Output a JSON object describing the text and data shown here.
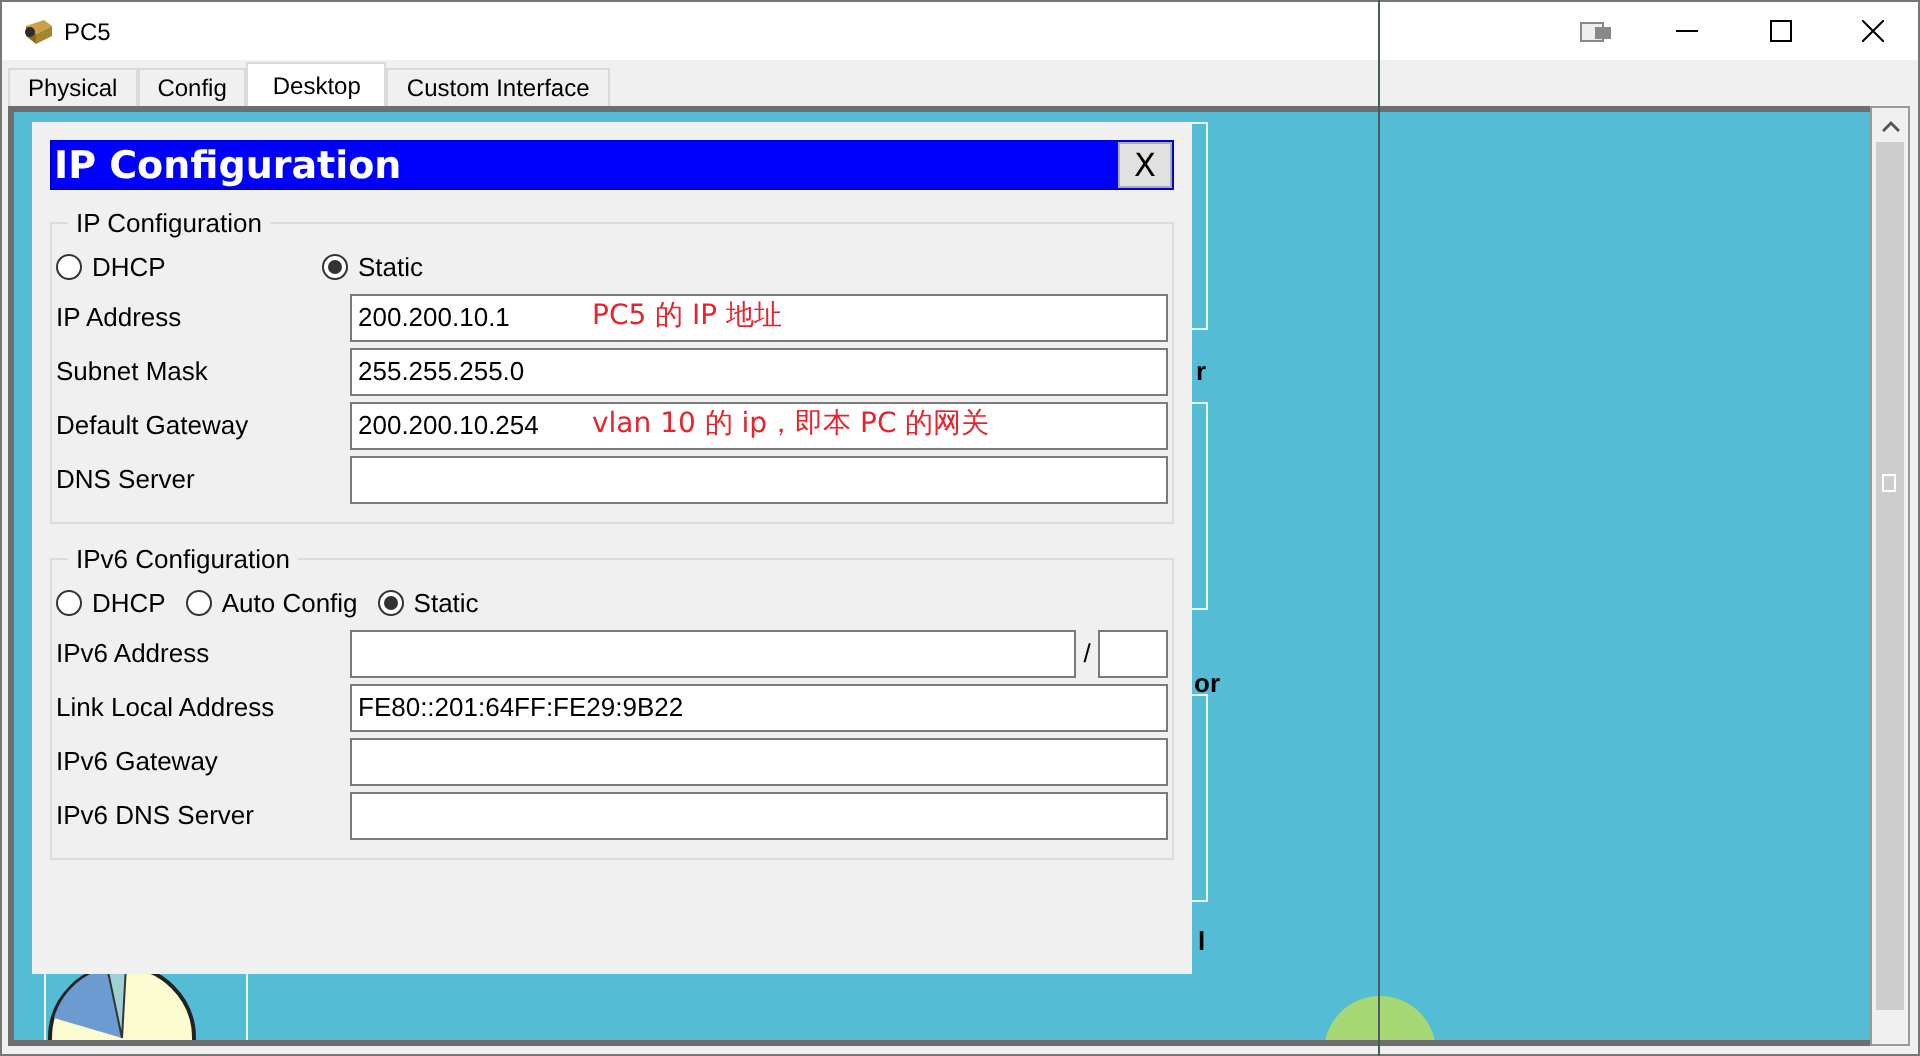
{
  "window": {
    "title": "PC5"
  },
  "tabs": [
    {
      "label": "Physical",
      "selected": false
    },
    {
      "label": "Config",
      "selected": false
    },
    {
      "label": "Desktop",
      "selected": true
    },
    {
      "label": "Custom Interface",
      "selected": false
    }
  ],
  "desktop": {
    "fragments": [
      "r",
      "or",
      "l"
    ]
  },
  "dialog": {
    "title": "IP Configuration",
    "close": "X",
    "ipv4": {
      "legend": "IP Configuration",
      "modes": [
        {
          "label": "DHCP",
          "selected": false
        },
        {
          "label": "Static",
          "selected": true
        }
      ],
      "fields": [
        {
          "label": "IP Address",
          "value": "200.200.10.1",
          "note": "PC5 的 IP 地址"
        },
        {
          "label": "Subnet Mask",
          "value": "255.255.255.0"
        },
        {
          "label": "Default Gateway",
          "value": "200.200.10.254",
          "note": "vlan 10 的 ip，即本 PC 的网关"
        },
        {
          "label": "DNS Server"
        }
      ]
    },
    "ipv6": {
      "legend": "IPv6 Configuration",
      "modes": [
        {
          "label": "DHCP",
          "selected": false
        },
        {
          "label": "Auto Config",
          "selected": false
        },
        {
          "label": "Static",
          "selected": true
        }
      ],
      "fields": [
        {
          "label": "IPv6 Address",
          "kind": "prefix",
          "separator": "/"
        },
        {
          "label": "Link Local Address",
          "value": "FE80::201:64FF:FE29:9B22"
        },
        {
          "label": "IPv6 Gateway"
        },
        {
          "label": "IPv6 DNS Server"
        }
      ]
    }
  }
}
